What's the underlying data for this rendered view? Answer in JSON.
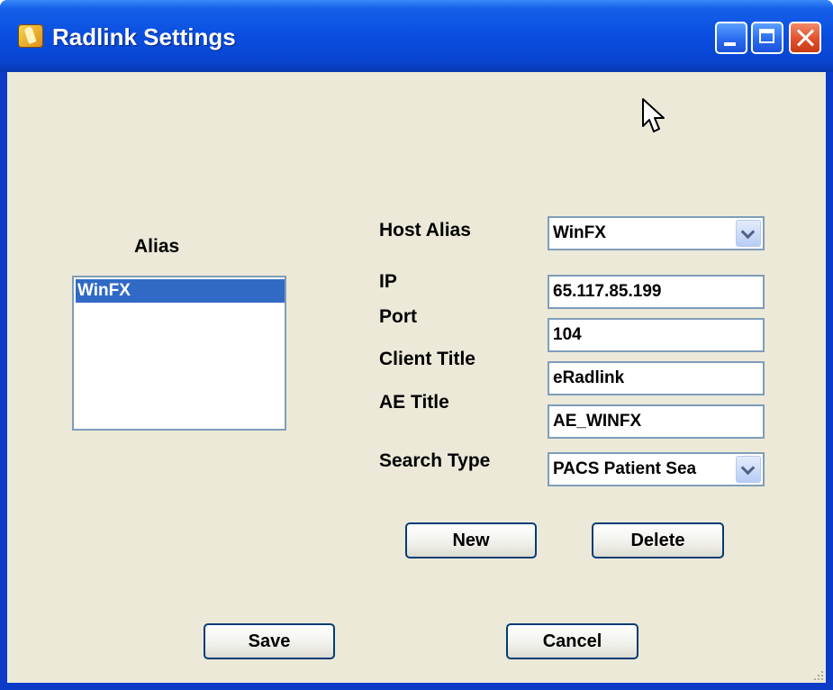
{
  "window": {
    "title": "Radlink Settings",
    "app_icon": "radlink-hand-icon"
  },
  "title_controls": {
    "minimize": "minimize-icon",
    "maximize": "maximize-icon",
    "close": "close-icon"
  },
  "alias_panel": {
    "label": "Alias",
    "items": [
      "WinFX"
    ],
    "selected_index": 0
  },
  "form": {
    "host_alias": {
      "label": "Host Alias",
      "value": "WinFX"
    },
    "ip": {
      "label": "IP",
      "value": "65.117.85.199"
    },
    "port": {
      "label": "Port",
      "value": "104"
    },
    "client_title": {
      "label": "Client Title",
      "value": "eRadlink"
    },
    "ae_title": {
      "label": "AE Title",
      "value": "AE_WINFX"
    },
    "search_type": {
      "label": "Search Type",
      "value": "PACS Patient Sea"
    }
  },
  "buttons": {
    "new": "New",
    "delete": "Delete",
    "save": "Save",
    "cancel": "Cancel"
  },
  "colors": {
    "titlebar": "#0a4ee0",
    "client": "#ece9d8",
    "selection": "#316ac5",
    "border": "#7f9db9",
    "button_border": "#003c74"
  },
  "icons": {
    "pointer": "mouse-pointer-icon",
    "resize_grip": "resize-grip-icon",
    "dropdown": "chevron-down-icon"
  }
}
